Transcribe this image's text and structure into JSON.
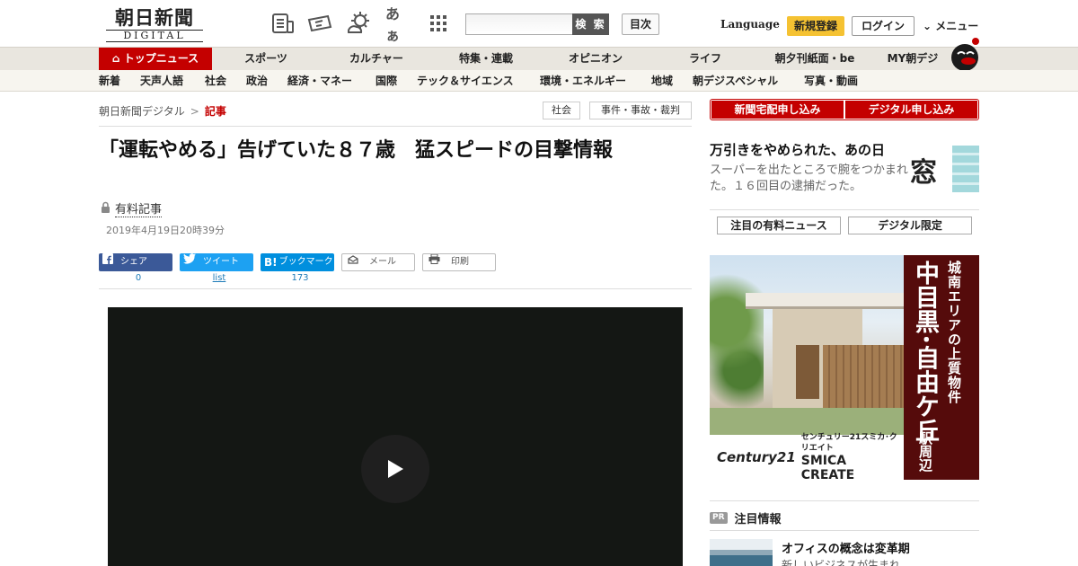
{
  "header": {
    "logo_main": "朝日新聞",
    "logo_sub": "DIGITAL",
    "font_size_label": "あぁ",
    "search_button": "検 索",
    "toc_button": "目次",
    "language": "Language",
    "register": "新規登録",
    "login": "ログイン",
    "menu": "メニュー"
  },
  "nav_main": [
    {
      "label": "トップニュース",
      "active": true
    },
    {
      "label": "スポーツ"
    },
    {
      "label": "カルチャー"
    },
    {
      "label": "特集・連載"
    },
    {
      "label": "オピニオン"
    },
    {
      "label": "ライフ"
    },
    {
      "label": "朝夕刊紙面・be"
    },
    {
      "label": "MY朝デジ"
    }
  ],
  "nav_sub": [
    "新着",
    "天声人語",
    "社会",
    "政治",
    "経済・マネー",
    "国際",
    "テック＆サイエンス",
    "環境・エネルギー",
    "地域",
    "朝デジスペシャル",
    "写真・動画"
  ],
  "breadcrumb": {
    "home": "朝日新聞デジタル",
    "sep": ">",
    "current": "記事"
  },
  "tags": [
    "社会",
    "事件・事故・裁判"
  ],
  "article": {
    "headline": "「運転やめる」告げていた８７歳　猛スピードの目撃情報",
    "paid_label": "有料記事",
    "date": "2019年4月19日20時39分"
  },
  "share": {
    "facebook": {
      "label": "シェア",
      "count": "0"
    },
    "twitter": {
      "label": "ツイート",
      "count": "list"
    },
    "hatena": {
      "label": "ブックマーク",
      "count": "173"
    },
    "mail": {
      "label": "メール"
    },
    "print": {
      "label": "印刷"
    }
  },
  "sidebar": {
    "subscribe_paper": "新聞宅配申し込み",
    "subscribe_digital": "デジタル申し込み",
    "promo_title": "万引きをやめられた、あの日",
    "promo_desc": "スーパーを出たところで腕をつかまれた。１６回目の逮捕だった。",
    "promo_logo": "窓",
    "tab_paid": "注目の有料ニュース",
    "tab_digital": "デジタル限定",
    "ad": {
      "brand_c21": "Century21",
      "company_jp": "センチュリー21スミカ･クリエイト",
      "company_en": "SMICA CREATE",
      "copy_small": "城南エリアの上質物件",
      "copy_big": "中目黒･自由ケ丘",
      "copy_tail": "駅周辺"
    },
    "pr_badge": "PR",
    "pr_title": "注目情報",
    "pr_item_title": "オフィスの概念は変革期",
    "pr_item_desc": "新しいビジネスが生まれ"
  },
  "colors": {
    "brand_red": "#c40000",
    "facebook": "#3b5998",
    "twitter": "#1da1f2",
    "hatena": "#008fde",
    "register_yellow": "#f5c232"
  }
}
